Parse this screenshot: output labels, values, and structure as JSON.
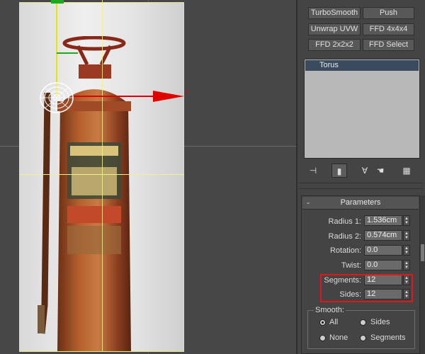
{
  "viewport": {
    "axis_x_label": "x"
  },
  "modifier_buttons": [
    {
      "label": "TurboSmooth"
    },
    {
      "label": "Push"
    },
    {
      "label": "Unwrap UVW"
    },
    {
      "label": "FFD 4x4x4"
    },
    {
      "label": "FFD 2x2x2"
    },
    {
      "label": "FFD Select"
    }
  ],
  "modifier_stack": {
    "items": [
      "Torus"
    ]
  },
  "stack_toolbar": {
    "icons": [
      "pin-stack-icon",
      "show-end-result-icon",
      "make-unique-icon",
      "remove-modifier-icon",
      "configure-modifier-sets-icon"
    ]
  },
  "parameters": {
    "title": "Parameters",
    "collapse_symbol": "-",
    "fields": [
      {
        "label": "Radius 1:",
        "value": "1.536cm"
      },
      {
        "label": "Radius 2:",
        "value": "0.574cm"
      },
      {
        "label": "Rotation:",
        "value": "0.0"
      },
      {
        "label": "Twist:",
        "value": "0.0"
      },
      {
        "label": "Segments:",
        "value": "12"
      },
      {
        "label": "Sides:",
        "value": "12"
      }
    ],
    "smooth": {
      "title": "Smooth:",
      "options": [
        "All",
        "Sides",
        "None",
        "Segments"
      ],
      "selected": "All"
    }
  },
  "colors": {
    "highlight_box": "#e01818",
    "gizmo_x": "#e00000",
    "gizmo_y": "#e6e600",
    "gizmo_z": "#1eaa1e",
    "stack_selection": "#394b5c"
  }
}
